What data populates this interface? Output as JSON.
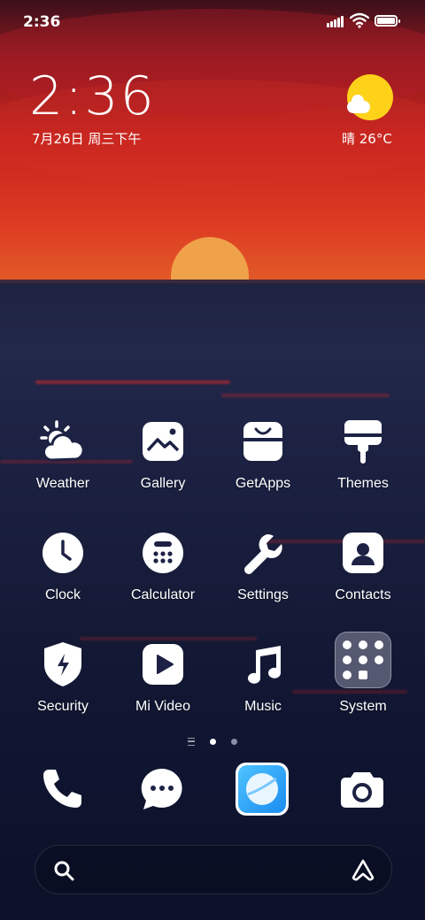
{
  "status_bar": {
    "time": "2:36",
    "battery_level": 1.0
  },
  "widget": {
    "time": "2:36",
    "date": "7月26日 周三下午",
    "weather_text": "晴 26°C",
    "weather_icon": "sun-cloud-icon"
  },
  "apps": [
    {
      "label": "Weather",
      "icon": "weather-icon"
    },
    {
      "label": "Gallery",
      "icon": "gallery-icon"
    },
    {
      "label": "GetApps",
      "icon": "getapps-icon"
    },
    {
      "label": "Themes",
      "icon": "themes-icon"
    },
    {
      "label": "Clock",
      "icon": "clock-icon"
    },
    {
      "label": "Calculator",
      "icon": "calculator-icon"
    },
    {
      "label": "Settings",
      "icon": "settings-icon"
    },
    {
      "label": "Contacts",
      "icon": "contacts-icon"
    },
    {
      "label": "Security",
      "icon": "security-icon"
    },
    {
      "label": "Mi Video",
      "icon": "mi-video-icon"
    },
    {
      "label": "Music",
      "icon": "music-icon"
    },
    {
      "label": "System",
      "icon": "system-folder-icon"
    }
  ],
  "page_indicator": {
    "pages": 2,
    "current": 1
  },
  "dock": [
    {
      "icon": "phone-icon"
    },
    {
      "icon": "messages-icon"
    },
    {
      "icon": "browser-icon"
    },
    {
      "icon": "camera-icon"
    }
  ],
  "search_bar": {
    "left_icon": "search-icon",
    "right_icon": "assistant-icon"
  }
}
